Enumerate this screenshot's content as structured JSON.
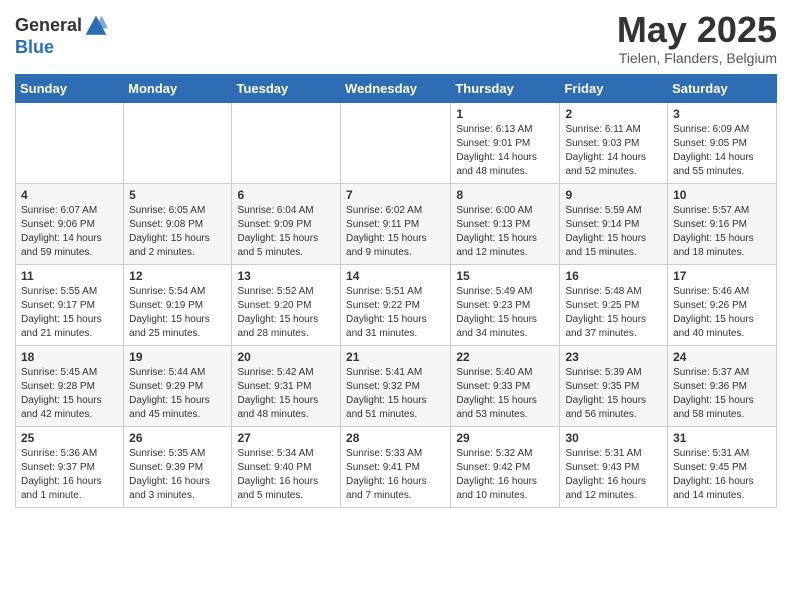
{
  "header": {
    "logo_general": "General",
    "logo_blue": "Blue",
    "title": "May 2025",
    "location": "Tielen, Flanders, Belgium"
  },
  "days_of_week": [
    "Sunday",
    "Monday",
    "Tuesday",
    "Wednesday",
    "Thursday",
    "Friday",
    "Saturday"
  ],
  "weeks": [
    [
      {
        "day": "",
        "info": ""
      },
      {
        "day": "",
        "info": ""
      },
      {
        "day": "",
        "info": ""
      },
      {
        "day": "",
        "info": ""
      },
      {
        "day": "1",
        "info": "Sunrise: 6:13 AM\nSunset: 9:01 PM\nDaylight: 14 hours\nand 48 minutes."
      },
      {
        "day": "2",
        "info": "Sunrise: 6:11 AM\nSunset: 9:03 PM\nDaylight: 14 hours\nand 52 minutes."
      },
      {
        "day": "3",
        "info": "Sunrise: 6:09 AM\nSunset: 9:05 PM\nDaylight: 14 hours\nand 55 minutes."
      }
    ],
    [
      {
        "day": "4",
        "info": "Sunrise: 6:07 AM\nSunset: 9:06 PM\nDaylight: 14 hours\nand 59 minutes."
      },
      {
        "day": "5",
        "info": "Sunrise: 6:05 AM\nSunset: 9:08 PM\nDaylight: 15 hours\nand 2 minutes."
      },
      {
        "day": "6",
        "info": "Sunrise: 6:04 AM\nSunset: 9:09 PM\nDaylight: 15 hours\nand 5 minutes."
      },
      {
        "day": "7",
        "info": "Sunrise: 6:02 AM\nSunset: 9:11 PM\nDaylight: 15 hours\nand 9 minutes."
      },
      {
        "day": "8",
        "info": "Sunrise: 6:00 AM\nSunset: 9:13 PM\nDaylight: 15 hours\nand 12 minutes."
      },
      {
        "day": "9",
        "info": "Sunrise: 5:59 AM\nSunset: 9:14 PM\nDaylight: 15 hours\nand 15 minutes."
      },
      {
        "day": "10",
        "info": "Sunrise: 5:57 AM\nSunset: 9:16 PM\nDaylight: 15 hours\nand 18 minutes."
      }
    ],
    [
      {
        "day": "11",
        "info": "Sunrise: 5:55 AM\nSunset: 9:17 PM\nDaylight: 15 hours\nand 21 minutes."
      },
      {
        "day": "12",
        "info": "Sunrise: 5:54 AM\nSunset: 9:19 PM\nDaylight: 15 hours\nand 25 minutes."
      },
      {
        "day": "13",
        "info": "Sunrise: 5:52 AM\nSunset: 9:20 PM\nDaylight: 15 hours\nand 28 minutes."
      },
      {
        "day": "14",
        "info": "Sunrise: 5:51 AM\nSunset: 9:22 PM\nDaylight: 15 hours\nand 31 minutes."
      },
      {
        "day": "15",
        "info": "Sunrise: 5:49 AM\nSunset: 9:23 PM\nDaylight: 15 hours\nand 34 minutes."
      },
      {
        "day": "16",
        "info": "Sunrise: 5:48 AM\nSunset: 9:25 PM\nDaylight: 15 hours\nand 37 minutes."
      },
      {
        "day": "17",
        "info": "Sunrise: 5:46 AM\nSunset: 9:26 PM\nDaylight: 15 hours\nand 40 minutes."
      }
    ],
    [
      {
        "day": "18",
        "info": "Sunrise: 5:45 AM\nSunset: 9:28 PM\nDaylight: 15 hours\nand 42 minutes."
      },
      {
        "day": "19",
        "info": "Sunrise: 5:44 AM\nSunset: 9:29 PM\nDaylight: 15 hours\nand 45 minutes."
      },
      {
        "day": "20",
        "info": "Sunrise: 5:42 AM\nSunset: 9:31 PM\nDaylight: 15 hours\nand 48 minutes."
      },
      {
        "day": "21",
        "info": "Sunrise: 5:41 AM\nSunset: 9:32 PM\nDaylight: 15 hours\nand 51 minutes."
      },
      {
        "day": "22",
        "info": "Sunrise: 5:40 AM\nSunset: 9:33 PM\nDaylight: 15 hours\nand 53 minutes."
      },
      {
        "day": "23",
        "info": "Sunrise: 5:39 AM\nSunset: 9:35 PM\nDaylight: 15 hours\nand 56 minutes."
      },
      {
        "day": "24",
        "info": "Sunrise: 5:37 AM\nSunset: 9:36 PM\nDaylight: 15 hours\nand 58 minutes."
      }
    ],
    [
      {
        "day": "25",
        "info": "Sunrise: 5:36 AM\nSunset: 9:37 PM\nDaylight: 16 hours\nand 1 minute."
      },
      {
        "day": "26",
        "info": "Sunrise: 5:35 AM\nSunset: 9:39 PM\nDaylight: 16 hours\nand 3 minutes."
      },
      {
        "day": "27",
        "info": "Sunrise: 5:34 AM\nSunset: 9:40 PM\nDaylight: 16 hours\nand 5 minutes."
      },
      {
        "day": "28",
        "info": "Sunrise: 5:33 AM\nSunset: 9:41 PM\nDaylight: 16 hours\nand 7 minutes."
      },
      {
        "day": "29",
        "info": "Sunrise: 5:32 AM\nSunset: 9:42 PM\nDaylight: 16 hours\nand 10 minutes."
      },
      {
        "day": "30",
        "info": "Sunrise: 5:31 AM\nSunset: 9:43 PM\nDaylight: 16 hours\nand 12 minutes."
      },
      {
        "day": "31",
        "info": "Sunrise: 5:31 AM\nSunset: 9:45 PM\nDaylight: 16 hours\nand 14 minutes."
      }
    ]
  ]
}
